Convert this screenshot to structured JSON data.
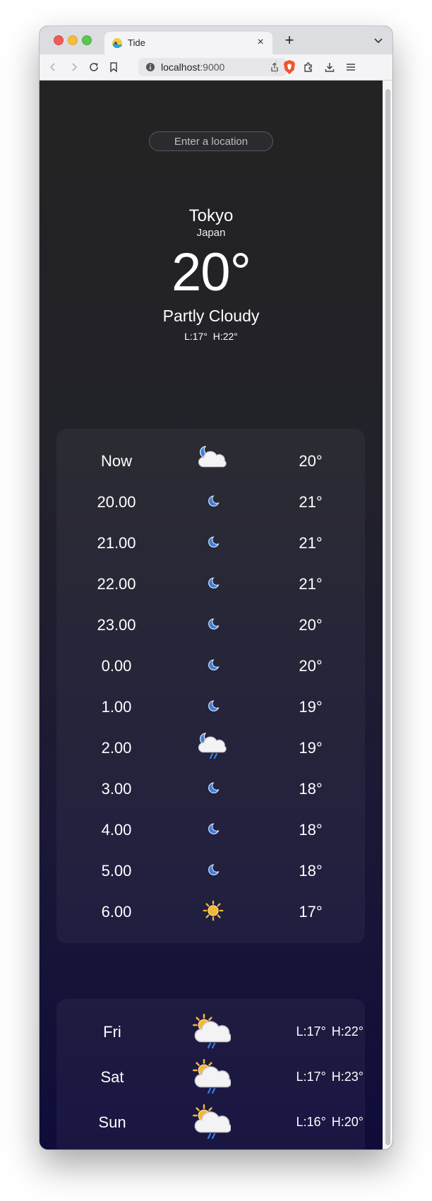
{
  "browser": {
    "tab_title": "Tide",
    "url_host": "localhost",
    "url_port": ":9000"
  },
  "search": {
    "placeholder": "Enter a location"
  },
  "current": {
    "city": "Tokyo",
    "country": "Japan",
    "temp": "20°",
    "condition": "Partly Cloudy",
    "low": "L:17°",
    "high": "H:22°"
  },
  "hourly": [
    {
      "time": "Now",
      "icon": "moon-cloud-icon",
      "temp": "20°"
    },
    {
      "time": "20.00",
      "icon": "moon-icon",
      "temp": "21°"
    },
    {
      "time": "21.00",
      "icon": "moon-icon",
      "temp": "21°"
    },
    {
      "time": "22.00",
      "icon": "moon-icon",
      "temp": "21°"
    },
    {
      "time": "23.00",
      "icon": "moon-icon",
      "temp": "20°"
    },
    {
      "time": "0.00",
      "icon": "moon-icon",
      "temp": "20°"
    },
    {
      "time": "1.00",
      "icon": "moon-icon",
      "temp": "19°"
    },
    {
      "time": "2.00",
      "icon": "moon-cloud-rain-icon",
      "temp": "19°"
    },
    {
      "time": "3.00",
      "icon": "moon-icon",
      "temp": "18°"
    },
    {
      "time": "4.00",
      "icon": "moon-icon",
      "temp": "18°"
    },
    {
      "time": "5.00",
      "icon": "moon-icon",
      "temp": "18°"
    },
    {
      "time": "6.00",
      "icon": "sun-icon",
      "temp": "17°"
    }
  ],
  "daily": [
    {
      "day": "Fri",
      "icon": "sun-cloud-rain-icon",
      "low": "L:17°",
      "high": "H:22°"
    },
    {
      "day": "Sat",
      "icon": "sun-cloud-rain-icon",
      "low": "L:17°",
      "high": "H:23°"
    },
    {
      "day": "Sun",
      "icon": "sun-cloud-rain-icon",
      "low": "L:16°",
      "high": "H:20°"
    }
  ],
  "colors": {
    "moon": "#3b7fe0",
    "sun": "#f7b731",
    "cloud": "#f3f3f6",
    "rain": "#3b7fe0"
  }
}
